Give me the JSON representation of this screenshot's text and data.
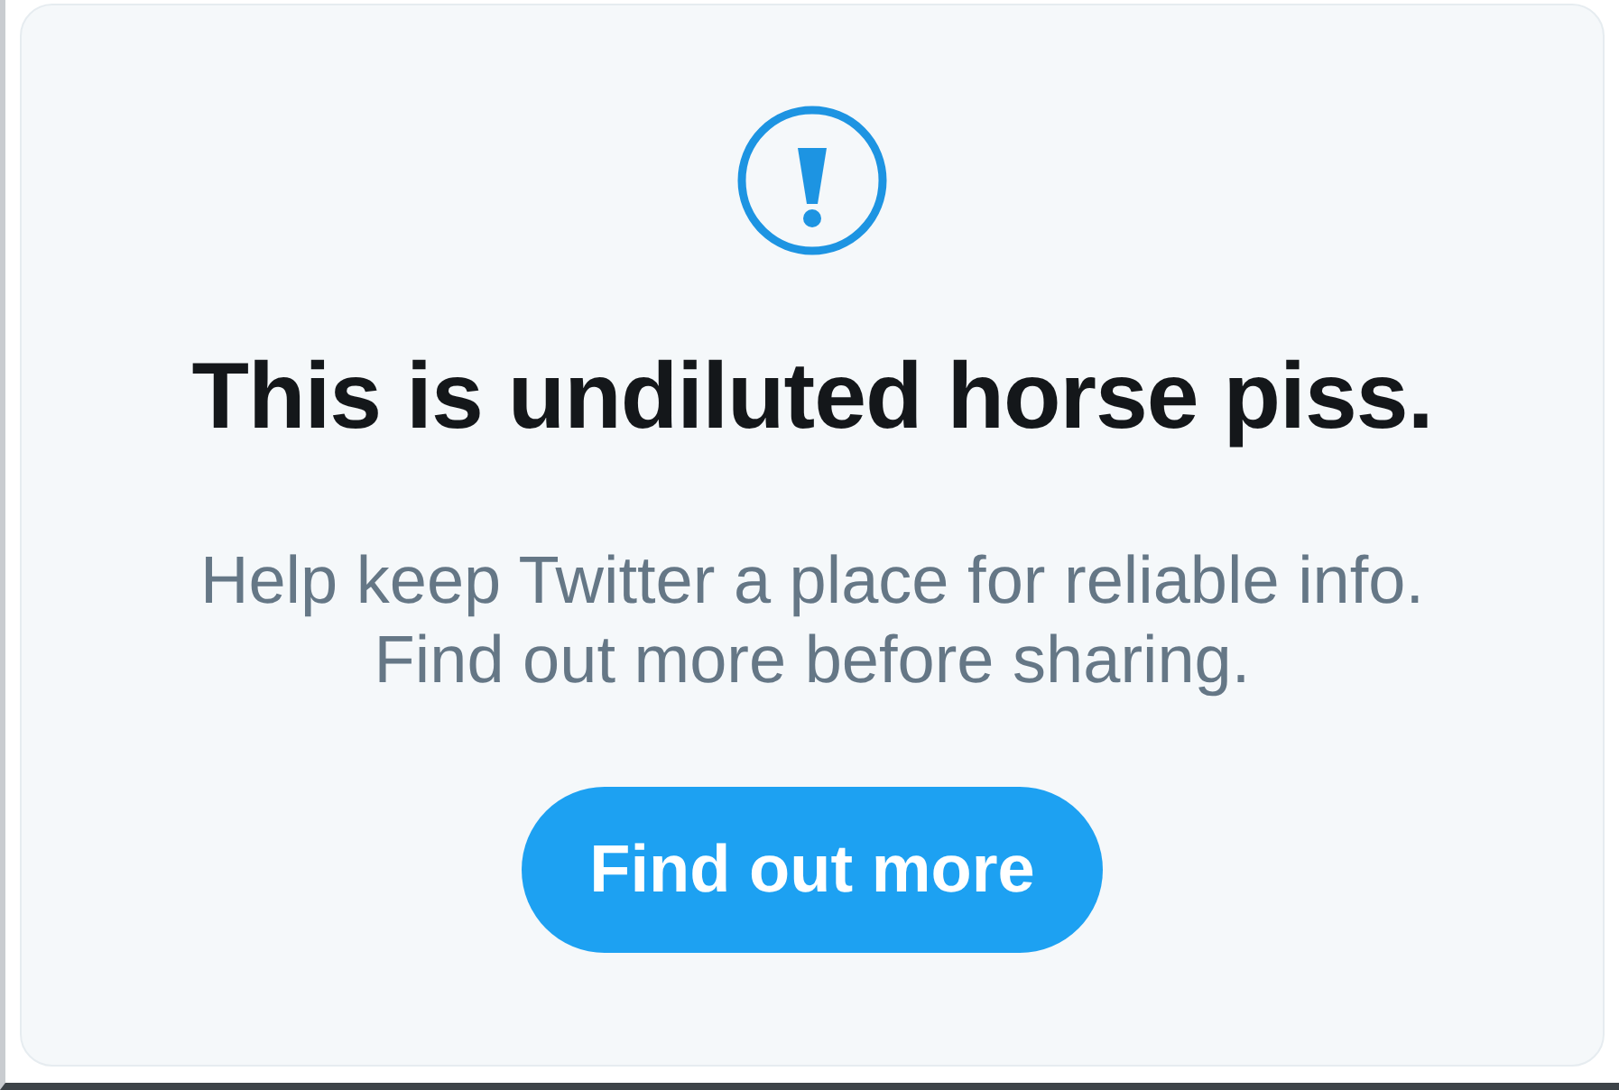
{
  "notice": {
    "title": "This is undiluted horse piss.",
    "message_lines": [
      "Help keep Twitter a place for reliable info.",
      "Find out more before sharing."
    ],
    "button": {
      "label": "Find out more"
    }
  }
}
